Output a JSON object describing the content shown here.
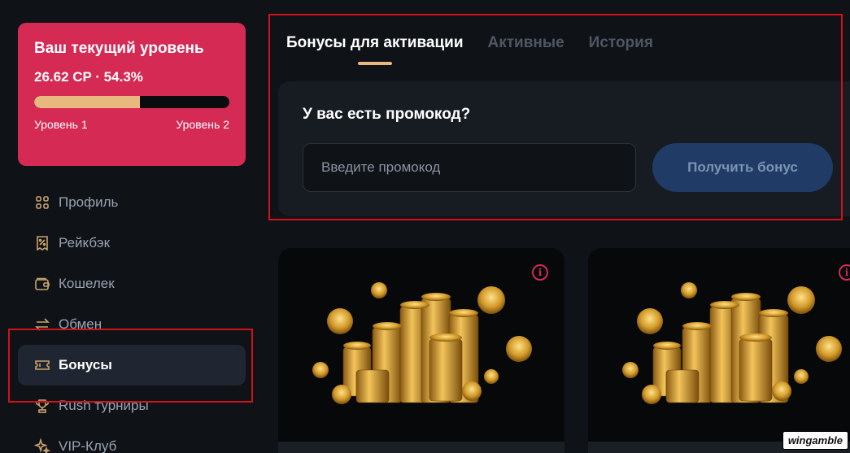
{
  "level_card": {
    "title": "Ваш текущий уровень",
    "points": "26.62 CP · 54.3%",
    "progress": 0.543,
    "level_from": "Уровень 1",
    "level_to": "Уровень 2",
    "accent": "#d42a54",
    "fill_color": "#e8b87e"
  },
  "sidebar": {
    "items": [
      {
        "label": "Профиль",
        "icon": "grid-icon",
        "active": false
      },
      {
        "label": "Рейкбэк",
        "icon": "percent-receipt-icon",
        "active": false
      },
      {
        "label": "Кошелек",
        "icon": "wallet-icon",
        "active": false
      },
      {
        "label": "Обмен",
        "icon": "exchange-icon",
        "active": false
      },
      {
        "label": "Бонусы",
        "icon": "ticket-icon",
        "active": true
      },
      {
        "label": "Rush турниры",
        "icon": "trophy-icon",
        "active": false
      },
      {
        "label": "VIP-Клуб",
        "icon": "sparkle-icon",
        "active": false
      }
    ]
  },
  "tabs": [
    {
      "label": "Бонусы для активации",
      "active": true
    },
    {
      "label": "Активные",
      "active": false
    },
    {
      "label": "История",
      "active": false
    }
  ],
  "promo": {
    "title": "У вас есть промокод?",
    "input_placeholder": "Введите промокод",
    "input_value": "",
    "button_label": "Получить бонус"
  },
  "cards": [
    {
      "info_icon": "info-icon",
      "image": "gold-coins-stack"
    },
    {
      "info_icon": "info-icon",
      "image": "gold-coins-stack"
    }
  ],
  "watermark": "wingamble"
}
